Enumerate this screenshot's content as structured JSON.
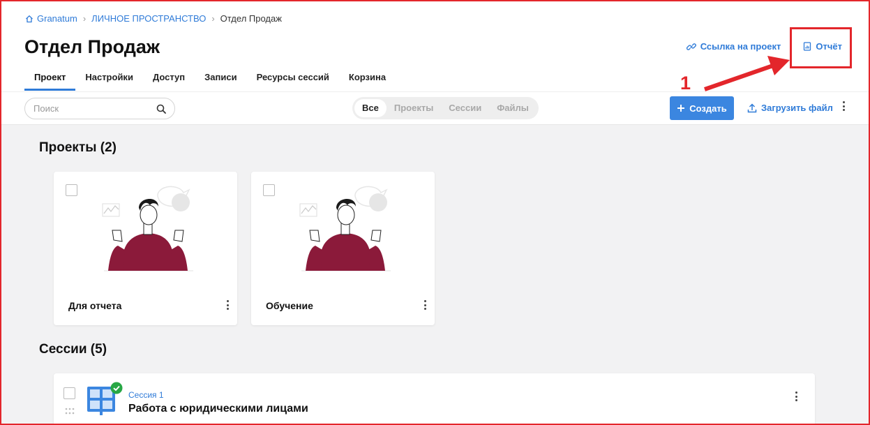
{
  "breadcrumb": {
    "home": "Granatum",
    "space": "ЛИЧНОЕ ПРОСТРАНСТВО",
    "current": "Отдел Продаж"
  },
  "page_title": "Отдел Продаж",
  "header_actions": {
    "link": "Ссылка на проект",
    "report": "Отчёт"
  },
  "annotation": {
    "step": "1",
    "color": "#e3262b"
  },
  "tabs": [
    {
      "label": "Проект",
      "active": true
    },
    {
      "label": "Настройки"
    },
    {
      "label": "Доступ"
    },
    {
      "label": "Записи"
    },
    {
      "label": "Ресурсы сессий"
    },
    {
      "label": "Корзина"
    }
  ],
  "toolbar": {
    "search_placeholder": "Поиск",
    "filters": [
      "Все",
      "Проекты",
      "Сессии",
      "Файлы"
    ],
    "create": "Создать",
    "upload": "Загрузить файл"
  },
  "projects": {
    "title": "Проекты (2)",
    "items": [
      {
        "title": "Для отчета"
      },
      {
        "title": "Обучение"
      }
    ]
  },
  "sessions": {
    "title": "Сессии (5)",
    "items": [
      {
        "number": "Сессия 1",
        "title": "Работа с юридическими лицами"
      }
    ]
  },
  "colors": {
    "accent": "#2f7bd8",
    "primary_button": "#3b86e0",
    "illustration": "#8b1a3a",
    "badge": "#28a745"
  }
}
